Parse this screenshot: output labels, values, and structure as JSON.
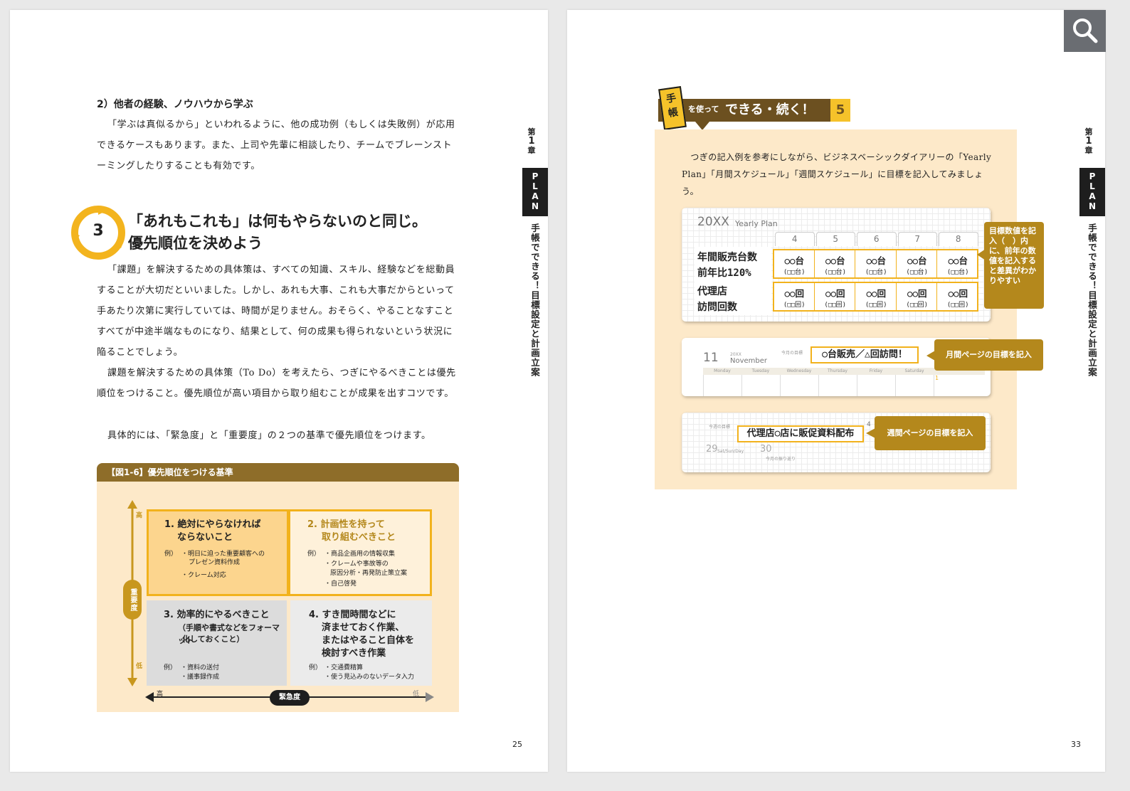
{
  "left_page": {
    "subheading": "2）他者の経験、ノウハウから学ぶ",
    "para1": "「学ぶは真似るから」といわれるように、他の成功例（もしくは失敗例）が応用できるケースもあります。また、上司や先輩に相談したり、チームでブレーンストーミングしたりすることも有効です。",
    "section_number": "3",
    "section_title_line1": "「あれもこれも」は何もやらないのと同じ。",
    "section_title_line2": "優先順位を決めよう",
    "para2": "「課題」を解決するための具体策は、すべての知識、スキル、経験などを総動員することが大切だといいました。しかし、あれも大事、これも大事だからといって手あたり次第に実行していては、時間が足りません。おそらく、やることなすことすべてが中途半端なものになり、結果として、何の成果も得られないという状況に陥ることでしょう。",
    "para3": "課題を解決するための具体策（To Do）を考えたら、つぎにやるべきことは優先順位をつけること。優先順位が高い項目から取り組むことが成果を出すコツです。",
    "para4": "具体的には、「緊急度」と「重要度」の２つの基準で優先順位をつけます。",
    "page_number": "25",
    "figure": {
      "caption": "【図1-6】優先順位をつける基準",
      "y_axis_label": "重要度",
      "y_high": "高",
      "y_low": "低",
      "x_axis_label": "緊急度",
      "x_high": "高",
      "x_low": "低",
      "q1": {
        "title1": "1. 絶対にやらなければ",
        "title2": "ならないこと",
        "ex_prefix": "例）",
        "ex1": "・明日に迫った重要顧客への",
        "ex1b": "プレゼン資料作成",
        "ex2": "・クレーム対応"
      },
      "q2": {
        "title1": "2. 計画性を持って",
        "title2": "取り組むべきこと",
        "ex_prefix": "例）",
        "ex1": "・商品企画用の情報収集",
        "ex2": "・クレームや事故等の",
        "ex2b": "原因分析・再発防止策立案",
        "ex3": "・自己啓発"
      },
      "q3": {
        "title1": "3. 効率的にやるべきこと",
        "title2": "（手順や書式などをフォーマット",
        "title3": "化しておくこと）",
        "ex_prefix": "例）",
        "ex1": "・資料の送付",
        "ex2": "・議事録作成"
      },
      "q4": {
        "title1": "4. すき間時間などに",
        "title2": "済ませておく作業、",
        "title3": "またはやること自体を",
        "title4": "検討すべき作業",
        "ex_prefix": "例）",
        "ex1": "・交通費精算",
        "ex2": "・使う見込みのないデータ入力"
      }
    }
  },
  "side_tab": {
    "chapter_char1": "第",
    "chapter_num": "1",
    "chapter_char2": "章",
    "plan_p": "P",
    "plan_l": "L",
    "plan_a": "A",
    "plan_n": "N",
    "vertical_title": "手帳でできる！目標設定と計画立案"
  },
  "right_page": {
    "banner_tag_1": "手",
    "banner_tag_2": "帳",
    "banner_mid": "を使って",
    "banner_main": "できる・続く！",
    "banner_num": "5",
    "intro": "　つぎの記入例を参考にしながら、ビジネスベーシックダイアリーの「Yearly Plan」「月間スケジュール」「週間スケジュール」に目標を記入してみましょう。",
    "page_number": "33",
    "yearly": {
      "year": "20XX",
      "label": "Yearly Plan",
      "months": [
        "4",
        "5",
        "6",
        "7",
        "8"
      ],
      "row1_label1": "年間販売台数",
      "row1_label2": "前年比120%",
      "row1_a": "○○台",
      "row1_b": "(□□台)",
      "row2_label1": "代理店",
      "row2_label2": "訪問回数",
      "row2_a": "○○回",
      "row2_b": "(□□回)",
      "callout": "目標数値を記入（　）内に、前年の数値を記入すると差異がわかりやすい"
    },
    "monthly": {
      "day": "11",
      "year": "20XX",
      "month": "November",
      "goal_small": "今月の目標",
      "goal": "○台販売／△回訪問！",
      "days": [
        "Monday",
        "Tuesday",
        "Wednesday",
        "Thursday",
        "Friday",
        "Saturday"
      ],
      "date_1": "1",
      "callout": "月間ページの目標を記入"
    },
    "weekly": {
      "goal_small": "今週の目標",
      "goal": "代理店○店に販促資料配布",
      "side_num": "4",
      "d1": "29",
      "d1_label": "Sat/Sun/Day",
      "d2": "30",
      "review": "今月の振り返り",
      "callout": "週間ページの目標を記入"
    }
  }
}
